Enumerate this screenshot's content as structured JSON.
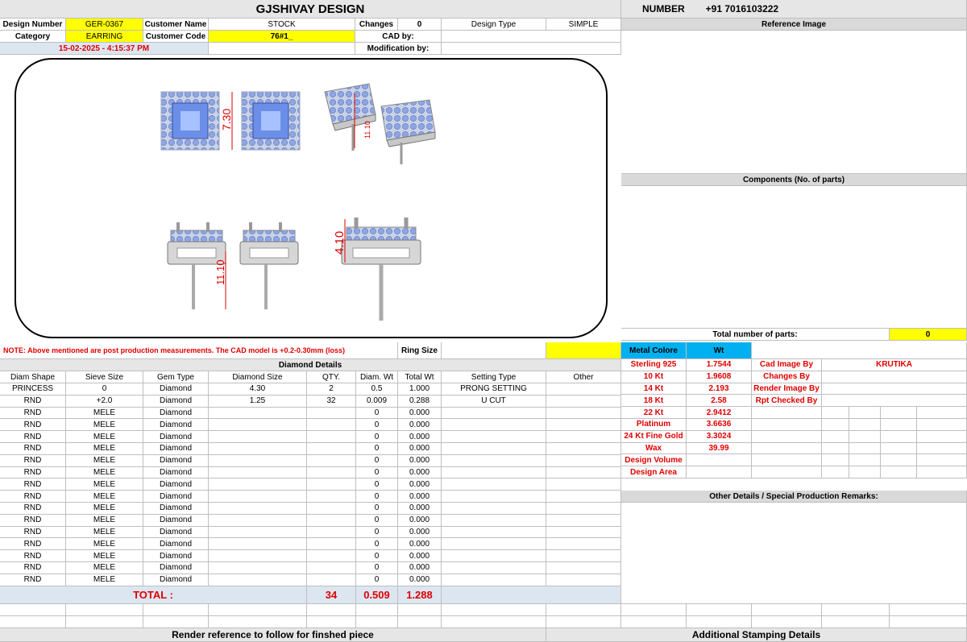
{
  "header": {
    "title": "GJSHIVAY DESIGN",
    "number_label": "NUMBER",
    "number_value": "+91 7016103222"
  },
  "info": {
    "design_number_label": "Design Number",
    "design_number": "GER-0367",
    "customer_name_label": "Customer Name",
    "customer_name": "STOCK",
    "changes_label": "Changes",
    "changes_value": "0",
    "design_type_label": "Design Type",
    "design_type": "SIMPLE",
    "category_label": "Category",
    "category": "EARRING",
    "customer_code_label": "Customer Code",
    "customer_code": "76#1_",
    "cad_by_label": "CAD by:",
    "timestamp": "15-02-2025 - 4:15:37 PM",
    "modification_by_label": "Modification by:"
  },
  "right_panel": {
    "reference_image": "Reference Image",
    "components": "Components (No. of parts)",
    "total_parts_label": "Total number of parts:",
    "total_parts_value": "0"
  },
  "dims": {
    "d1": "7.30",
    "d2": "11.10",
    "d3": "11.10",
    "d4": "4.10"
  },
  "note": "NOTE: Above mentioned are post production measurements. The CAD model is +0.2-0.30mm (loss)",
  "ring_size_label": "Ring Size",
  "diamond": {
    "title": "Diamond Details",
    "headers": [
      "Diam Shape",
      "Sieve Size",
      "Gem Type",
      "Diamond Size",
      "QTY.",
      "Diam. Wt",
      "Total Wt",
      "Setting Type",
      "Other"
    ],
    "rows": [
      [
        "PRINCESS",
        "0",
        "Diamond",
        "4.30",
        "2",
        "0.5",
        "1.000",
        "PRONG SETTING",
        ""
      ],
      [
        "RND",
        "+2.0",
        "Diamond",
        "1.25",
        "32",
        "0.009",
        "0.288",
        "U CUT",
        ""
      ],
      [
        "RND",
        "MELE",
        "Diamond",
        "",
        "",
        "0",
        "0.000",
        "",
        ""
      ],
      [
        "RND",
        "MELE",
        "Diamond",
        "",
        "",
        "0",
        "0.000",
        "",
        ""
      ],
      [
        "RND",
        "MELE",
        "Diamond",
        "",
        "",
        "0",
        "0.000",
        "",
        ""
      ],
      [
        "RND",
        "MELE",
        "Diamond",
        "",
        "",
        "0",
        "0.000",
        "",
        ""
      ],
      [
        "RND",
        "MELE",
        "Diamond",
        "",
        "",
        "0",
        "0.000",
        "",
        ""
      ],
      [
        "RND",
        "MELE",
        "Diamond",
        "",
        "",
        "0",
        "0.000",
        "",
        ""
      ],
      [
        "RND",
        "MELE",
        "Diamond",
        "",
        "",
        "0",
        "0.000",
        "",
        ""
      ],
      [
        "RND",
        "MELE",
        "Diamond",
        "",
        "",
        "0",
        "0.000",
        "",
        ""
      ],
      [
        "RND",
        "MELE",
        "Diamond",
        "",
        "",
        "0",
        "0.000",
        "",
        ""
      ],
      [
        "RND",
        "MELE",
        "Diamond",
        "",
        "",
        "0",
        "0.000",
        "",
        ""
      ],
      [
        "RND",
        "MELE",
        "Diamond",
        "",
        "",
        "0",
        "0.000",
        "",
        ""
      ],
      [
        "RND",
        "MELE",
        "Diamond",
        "",
        "",
        "0",
        "0.000",
        "",
        ""
      ],
      [
        "RND",
        "MELE",
        "Diamond",
        "",
        "",
        "0",
        "0.000",
        "",
        ""
      ],
      [
        "RND",
        "MELE",
        "Diamond",
        "",
        "",
        "0",
        "0.000",
        "",
        ""
      ],
      [
        "RND",
        "MELE",
        "Diamond",
        "",
        "",
        "0",
        "0.000",
        "",
        ""
      ]
    ],
    "total_label": "TOTAL :",
    "total_qty": "34",
    "total_diam_wt": "0.509",
    "total_wt": "1.288"
  },
  "metal": {
    "metal_label": "Metal Colore",
    "wt_label": "Wt",
    "rows": [
      [
        "Sterling 925",
        "1.7544"
      ],
      [
        "10 Kt",
        "1.9608"
      ],
      [
        "14 Kt",
        "2.193"
      ],
      [
        "18 Kt",
        "2.58"
      ],
      [
        "22 Kt",
        "2.9412"
      ],
      [
        "Platinum",
        "3.6636"
      ],
      [
        "24 Kt Fine Gold",
        "3.3024"
      ],
      [
        "Wax",
        "39.99"
      ],
      [
        "Design Volume",
        ""
      ],
      [
        "Design Area",
        ""
      ]
    ],
    "credits": [
      [
        "Cad Image By",
        "KRUTIKA"
      ],
      [
        "Changes By",
        ""
      ],
      [
        "Render Image By",
        ""
      ],
      [
        "Rpt Checked By",
        ""
      ]
    ]
  },
  "other_details": "Other Details / Special Production Remarks:",
  "footer": {
    "render_ref": "Render reference to follow for finshed piece",
    "stamping": "Additional Stamping Details"
  },
  "colors": {
    "yellow": "#ffff00",
    "red": "#e00000",
    "cyan": "#00b0f0",
    "light_blue": "#dce6f1"
  }
}
